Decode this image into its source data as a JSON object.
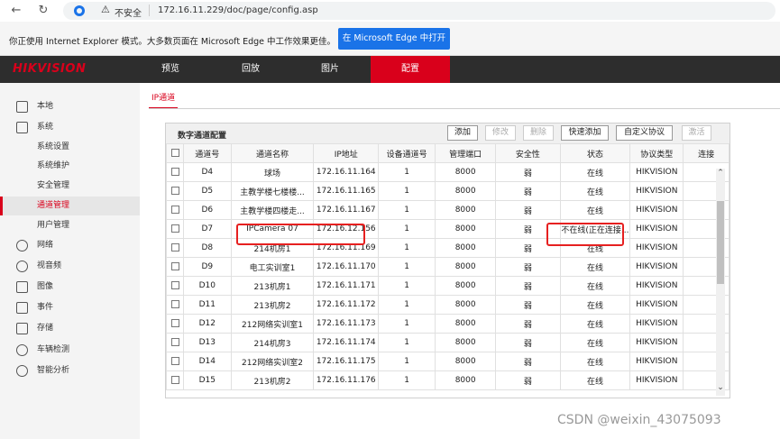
{
  "browser": {
    "insecure_label": "不安全",
    "url": "172.16.11.229/doc/page/config.asp",
    "ie_message": "你正使用 Internet Explorer 模式。大多数页面在 Microsoft Edge 中工作效果更佳。",
    "open_in_edge": "在 Microsoft Edge 中打开"
  },
  "brand": "HIKVISION",
  "topnav": [
    "预览",
    "回放",
    "图片",
    "配置"
  ],
  "sidebar": [
    "本地",
    "系统",
    "系统设置",
    "系统维护",
    "安全管理",
    "通道管理",
    "用户管理",
    "网络",
    "视音频",
    "图像",
    "事件",
    "存储",
    "车辆检测",
    "智能分析"
  ],
  "subtab": "IP通道",
  "panel": {
    "title": "数字通道配置",
    "buttons": [
      "添加",
      "修改",
      "删除",
      "快速添加",
      "自定义协议",
      "激活"
    ]
  },
  "table": {
    "headers": [
      "通道号",
      "通道名称",
      "IP地址",
      "设备通道号",
      "管理端口",
      "安全性",
      "状态",
      "协议类型",
      "连接"
    ],
    "rows": [
      [
        "D4",
        "球场",
        "172.16.11.164",
        "1",
        "8000",
        "弱",
        "在线",
        "HIKVISION"
      ],
      [
        "D5",
        "主教学楼七楼楼...",
        "172.16.11.165",
        "1",
        "8000",
        "弱",
        "在线",
        "HIKVISION"
      ],
      [
        "D6",
        "主教学楼四楼走...",
        "172.16.11.167",
        "1",
        "8000",
        "弱",
        "在线",
        "HIKVISION"
      ],
      [
        "D7",
        "IPCamera 07",
        "172.16.12.156",
        "1",
        "8000",
        "弱",
        "不在线(正在连接...",
        "HIKVISION"
      ],
      [
        "D8",
        "214机房1",
        "172.16.11.169",
        "1",
        "8000",
        "弱",
        "在线",
        "HIKVISION"
      ],
      [
        "D9",
        "电工实训室1",
        "172.16.11.170",
        "1",
        "8000",
        "弱",
        "在线",
        "HIKVISION"
      ],
      [
        "D10",
        "213机房1",
        "172.16.11.171",
        "1",
        "8000",
        "弱",
        "在线",
        "HIKVISION"
      ],
      [
        "D11",
        "213机房2",
        "172.16.11.172",
        "1",
        "8000",
        "弱",
        "在线",
        "HIKVISION"
      ],
      [
        "D12",
        "212网络实训室1",
        "172.16.11.173",
        "1",
        "8000",
        "弱",
        "在线",
        "HIKVISION"
      ],
      [
        "D13",
        "214机房3",
        "172.16.11.174",
        "1",
        "8000",
        "弱",
        "在线",
        "HIKVISION"
      ],
      [
        "D14",
        "212网络实训室2",
        "172.16.11.175",
        "1",
        "8000",
        "弱",
        "在线",
        "HIKVISION"
      ],
      [
        "D15",
        "213机房2",
        "172.16.11.176",
        "1",
        "8000",
        "弱",
        "在线",
        "HIKVISION"
      ]
    ]
  },
  "watermark": "CSDN @weixin_43075093",
  "colors": {
    "brand_red": "#d9001b",
    "nav_dark": "#2d2d2d",
    "edge_blue": "#1a73e8",
    "highlight": "#e62020"
  }
}
